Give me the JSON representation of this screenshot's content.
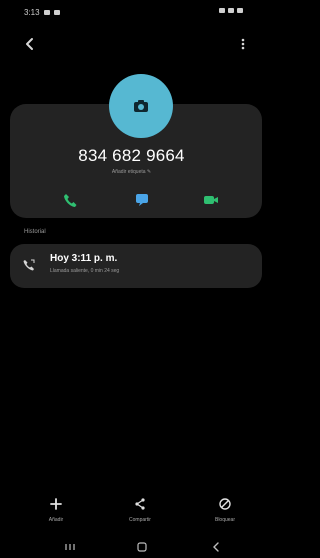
{
  "status_bar": {
    "time": "3:13"
  },
  "contact": {
    "phone_number": "834 682 9664",
    "subline": "Añadir etiqueta ✎"
  },
  "history": {
    "section_label": "Historial",
    "title": "Hoy 3:11 p. m.",
    "subtitle": "Llamada saliente, 0 min 24 seg"
  },
  "bottom_actions": {
    "add_label": "Añadir",
    "share_label": "Compartir",
    "block_label": "Bloquear"
  },
  "colors": {
    "avatar": "#56b8d2",
    "call": "#2fbf71",
    "message": "#4aa5e8",
    "video": "#2fbf71",
    "card": "#232323"
  },
  "icons": {
    "avatar": "camera-icon",
    "call": "phone-icon",
    "message": "message-icon",
    "video": "video-icon",
    "add": "plus-icon",
    "share": "share-icon",
    "block": "block-icon"
  }
}
